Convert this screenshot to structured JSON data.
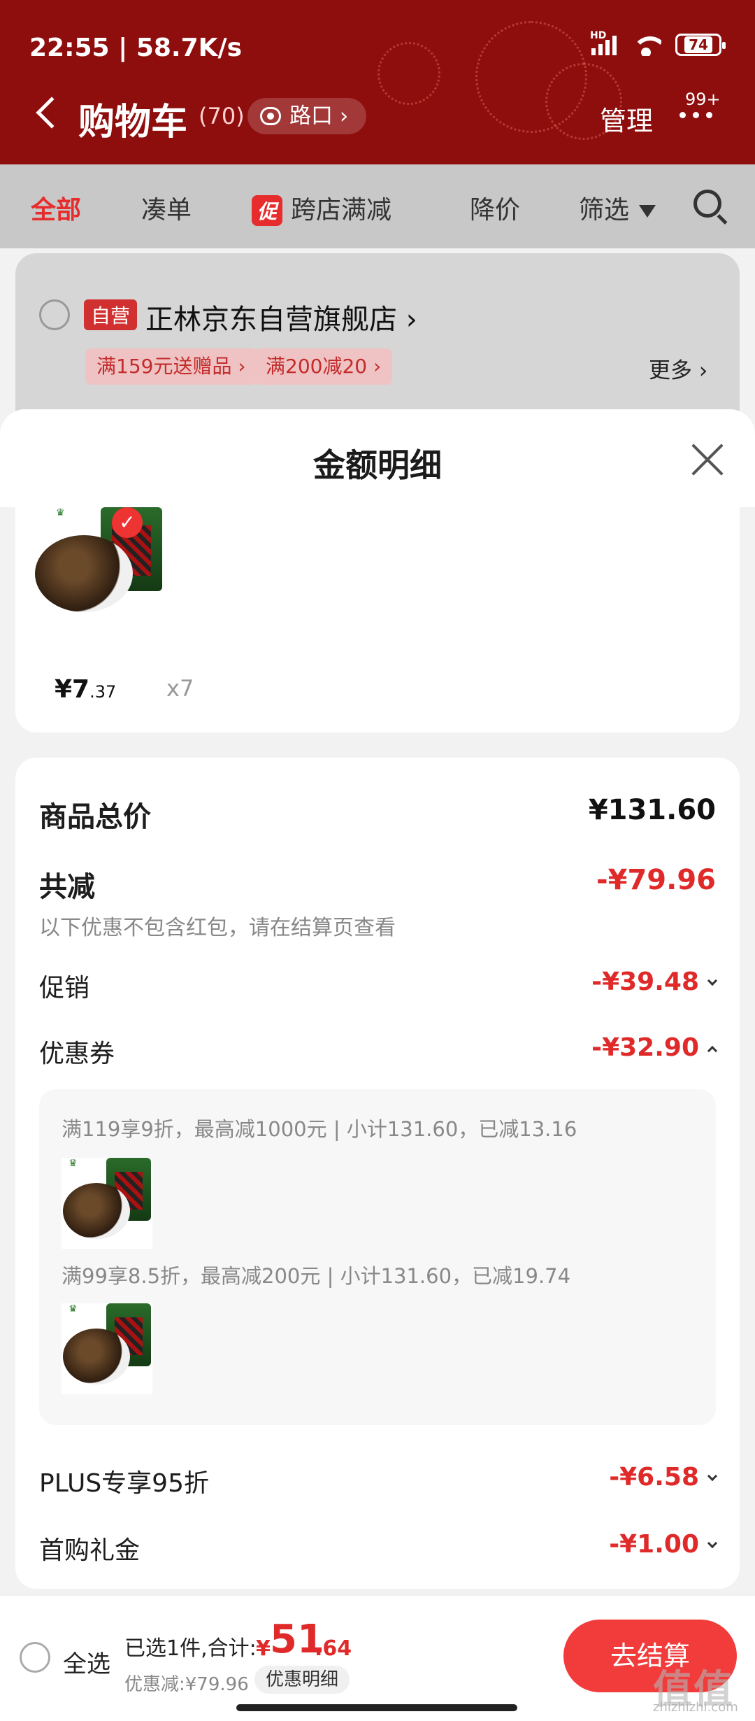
{
  "status": {
    "time": "22:55",
    "speed": "58.7K/s",
    "hd": "HD",
    "battery": "74"
  },
  "header": {
    "title": "购物车",
    "count": "(70)",
    "location": "路口",
    "manage": "管理",
    "badge": "99+"
  },
  "tabs": {
    "items": [
      "全部",
      "凑单",
      "跨店满减",
      "降价",
      "筛选"
    ],
    "promo_tag": "促"
  },
  "store": {
    "self_tag": "自营",
    "name": "正林京东自营旗舰店",
    "coupons": [
      "满159元送赠品",
      "满200减20"
    ],
    "more": "更多"
  },
  "sheet": {
    "title": "金额明细",
    "product": {
      "price_int": "¥7",
      "price_dec": ".37",
      "qty": "x7"
    },
    "summary": {
      "total_label": "商品总价",
      "total_value": "¥131.60",
      "reduce_label": "共减",
      "reduce_value": "-¥79.96",
      "reduce_note": "以下优惠不包含红包，请在结算页查看",
      "promo_label": "促销",
      "promo_value": "-¥39.48",
      "coupon_label": "优惠券",
      "coupon_value": "-¥32.90",
      "coupon_lines": [
        "满119享9折，最高减1000元 | 小计131.60，已减13.16",
        "满99享8.5折，最高减200元 | 小计131.60，已减19.74"
      ],
      "plus_label": "PLUS专享95折",
      "plus_value": "-¥6.58",
      "first_label": "首购礼金",
      "first_value": "-¥1.00"
    }
  },
  "bottom": {
    "select_all": "全选",
    "selected": "已选1件,合计:",
    "currency": "¥",
    "total_int": "51",
    "total_dec": ".64",
    "discount": "优惠减:¥79.96",
    "detail_btn": "优惠明细",
    "checkout": "去结算"
  },
  "watermark": {
    "main": "值值值",
    "sub": "zhizhizhi.com"
  },
  "colors": {
    "header_bg": "#8e0d0d",
    "accent_red": "#e02a2a",
    "checkout_bg": "#f23c3c"
  }
}
